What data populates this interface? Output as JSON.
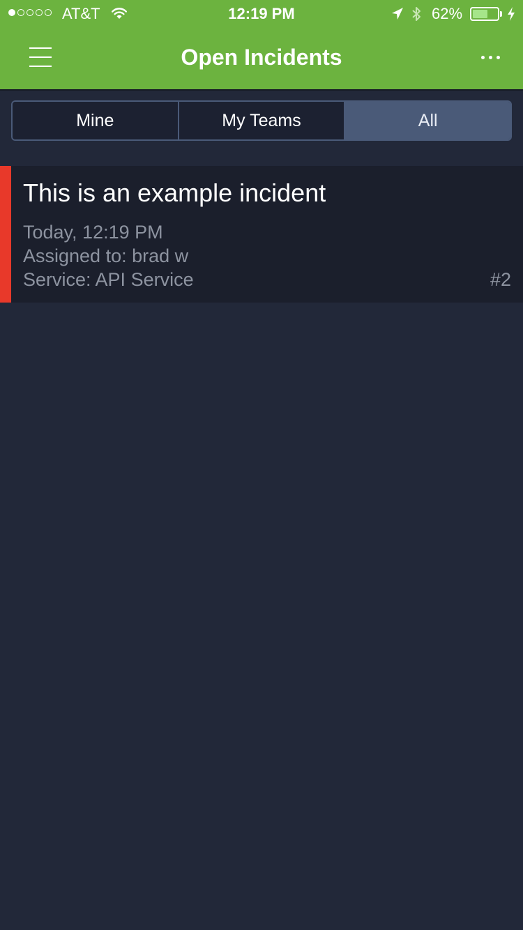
{
  "status_bar": {
    "carrier": "AT&T",
    "signal_bars_filled": 1,
    "signal_bars_total": 5,
    "time": "12:19 PM",
    "battery_percent": "62%",
    "battery_level": 0.62
  },
  "nav": {
    "title": "Open Incidents",
    "menu_icon": "hamburger-menu-icon",
    "more_icon": "more-horizontal-icon"
  },
  "segments": {
    "items": [
      {
        "label": "Mine",
        "selected": false
      },
      {
        "label": "My Teams",
        "selected": false
      },
      {
        "label": "All",
        "selected": true
      }
    ]
  },
  "incidents": [
    {
      "title": "This is an example incident",
      "time": "Today, 12:19 PM",
      "assigned": "Assigned to: brad w",
      "service": "Service: API Service",
      "number": "#2",
      "severity_color": "#e8392a"
    }
  ],
  "colors": {
    "brand_green": "#6cb33f",
    "background": "#222839",
    "card_background": "#1b1f2c",
    "segment_selected": "#4a5a78",
    "secondary_text": "#8d93a0"
  }
}
